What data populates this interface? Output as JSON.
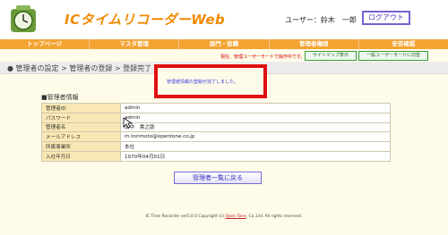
{
  "header": {
    "app_title": "ICタイムリコーダーWeb",
    "user_label": "ユーザー：鈴木　一郎",
    "logout_label": "ログアウト"
  },
  "nav": {
    "items": [
      {
        "label": "トップページ"
      },
      {
        "label": "マスタ管理"
      },
      {
        "label": "部門・役職"
      },
      {
        "label": "管理者権限"
      },
      {
        "label": "安否確認"
      }
    ]
  },
  "toolbar": {
    "mode_notice": "現在、管理ユーザーモードで操作中です。",
    "sitemap_label": "サイトマップ表示",
    "user_mode_label": "一般ユーザーモードに切替"
  },
  "breadcrumb": {
    "prefix": "●",
    "item1": "管理者の設定",
    "sep1": " > ",
    "item2": "管理者の登録",
    "sep2": " > ",
    "item3": "登録完了"
  },
  "alert": {
    "message": "管理者情報の登録が完了しました。"
  },
  "section": {
    "heading": "■管理者情報"
  },
  "table": {
    "rows": [
      {
        "label": "管理者ID",
        "value": "admin"
      },
      {
        "label": "パスワード",
        "value": "admin"
      },
      {
        "label": "管理者名",
        "value": "田中　貴之助"
      },
      {
        "label": "メールアドレス",
        "value": "m.torimoto@opentone.co.jp"
      },
      {
        "label": "所属事業所",
        "value": "本社"
      },
      {
        "label": "入社年月日",
        "value": "1970年04月01日"
      }
    ]
  },
  "actions": {
    "back_label": "管理者一覧に戻る"
  },
  "footer": {
    "prefix": "IC Time Recorder ver5.0.0 Copyright (c) ",
    "link": "Open Tone",
    "suffix": ", Co.,Ltd. All rights reserved."
  },
  "colors": {
    "brand_orange": "#f08a00",
    "nav_orange": "#f4a433",
    "alert_red": "#e01010",
    "label_bg": "#fae8b4"
  }
}
